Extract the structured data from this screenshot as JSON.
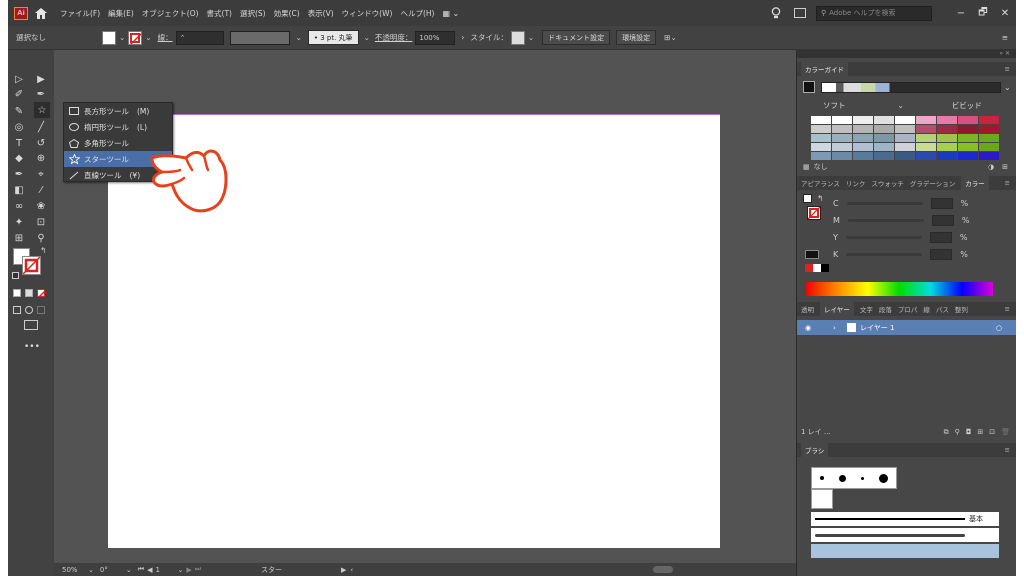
{
  "menubar": {
    "logo": "Ai",
    "menus": [
      "ファイル(F)",
      "編集(E)",
      "オブジェクト(O)",
      "書式(T)",
      "選択(S)",
      "効果(C)",
      "表示(V)",
      "ウィンドウ(W)",
      "ヘルプ(H)"
    ],
    "workspace_switcher": "▦ ⌄",
    "search_placeholder": "Adobe ヘルプを検索",
    "minimize": "−",
    "restore": "🗗",
    "close": "✕"
  },
  "control": {
    "selection": "選択なし",
    "stroke_label": "線：",
    "stroke_profile": "• 3 pt. 丸筆",
    "opacity_label": "不透明度：",
    "opacity_value": "100%",
    "style_label": "スタイル：",
    "doc_settings": "ドキュメント設定",
    "prefs": "環境設定"
  },
  "flyout": {
    "items": [
      {
        "label": "長方形ツール",
        "shortcut": "(M)"
      },
      {
        "label": "楕円形ツール",
        "shortcut": "(L)"
      },
      {
        "label": "多角形ツール",
        "shortcut": ""
      },
      {
        "label": "スターツール",
        "shortcut": ""
      },
      {
        "label": "直線ツール",
        "shortcut": "(¥)"
      }
    ]
  },
  "status": {
    "zoom": "50%",
    "rotation": "0°",
    "artboard": "1",
    "tool": "スター"
  },
  "color_guide": {
    "tab": "カラーガイド",
    "soft": "ソフト",
    "vivid": "ビビッド",
    "footer": "なし"
  },
  "color_panel": {
    "tabs": [
      "アピアランス",
      "リンク",
      "スウォッチ",
      "グラデーション",
      "カラー"
    ],
    "channels": [
      "C",
      "M",
      "Y",
      "K"
    ],
    "unit": "%"
  },
  "layers_panel": {
    "tabs": [
      "透明",
      "レイヤー",
      "文字",
      "段落",
      "プロパ",
      "線",
      "パス",
      "整列"
    ],
    "layer_name": "レイヤー 1",
    "count": "1 レイ ..."
  },
  "brush_panel": {
    "tab": "ブラシ",
    "basic_label": "基本"
  },
  "colors": {
    "accent": "#4a6fa8",
    "hand": "#e8401c",
    "artboard_border": "#b56bd8"
  }
}
